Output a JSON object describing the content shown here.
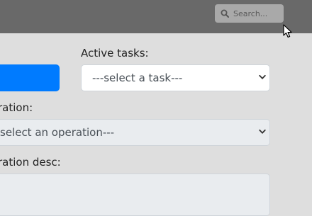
{
  "topbar": {
    "search": {
      "placeholder": "Search..."
    },
    "background_color": "#696969"
  },
  "form": {
    "primary_button": {
      "label": "",
      "color": "#007bff"
    },
    "active_tasks": {
      "label": "Active tasks:",
      "selected": "---select a task---"
    },
    "operation": {
      "label": "ration:",
      "selected": "select an operation---"
    },
    "operation_desc": {
      "label": "ration desc:",
      "value": ""
    }
  },
  "icons": {
    "search": "magnifier",
    "dropdown": "chevron-down",
    "cursor": "mouse-pointer"
  }
}
